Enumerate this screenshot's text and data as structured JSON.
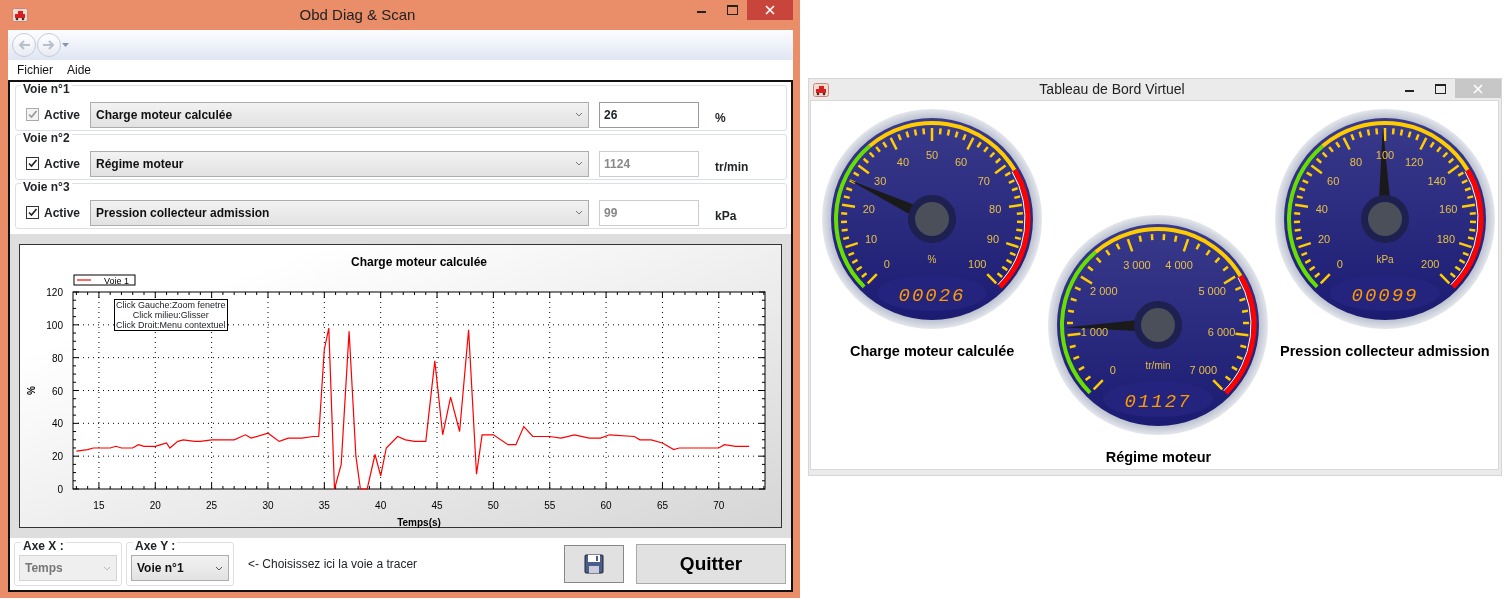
{
  "main_window": {
    "title": "Obd Diag & Scan",
    "menu": [
      "Fichier",
      "Aide"
    ],
    "channels": [
      {
        "group": "Voie n°1",
        "active": {
          "label": "Active",
          "checked": true,
          "disabled": true
        },
        "parameter": "Charge moteur calculée",
        "value": {
          "text": "26",
          "disabled": false
        },
        "unit": "%"
      },
      {
        "group": "Voie n°2",
        "active": {
          "label": "Active",
          "checked": true,
          "disabled": false
        },
        "parameter": "Régime moteur",
        "value": {
          "text": "1124",
          "disabled": true
        },
        "unit": "tr/min"
      },
      {
        "group": "Voie n°3",
        "active": {
          "label": "Active",
          "checked": true,
          "disabled": false
        },
        "parameter": "Pression collecteur admission",
        "value": {
          "text": "99",
          "disabled": true
        },
        "unit": "kPa"
      }
    ],
    "chart": {
      "help_box": [
        "Click Gauche:Zoom fenetre",
        "Click milieu:Glisser",
        "Click Droit:Menu contextuel"
      ],
      "chart_data": {
        "type": "line",
        "title": "Charge moteur calculée",
        "xlabel": "Temps(s)",
        "ylabel": "%",
        "x": [
          13,
          14,
          14.5,
          16,
          16.5,
          17,
          18,
          18.5,
          19,
          20,
          20.5,
          21,
          21.3,
          22,
          22.5,
          23.5,
          24,
          25,
          27,
          28,
          28.5,
          30,
          31,
          31.8,
          33,
          34,
          34.5,
          35,
          35.4,
          35.9,
          36.5,
          37.2,
          37.8,
          38.2,
          38.8,
          39.5,
          40,
          40.5,
          41.5,
          42.2,
          43,
          44,
          44.8,
          45.5,
          46.2,
          47,
          47.8,
          48.5,
          49,
          50,
          51.3,
          52,
          52.7,
          53.5,
          55,
          56,
          57.2,
          58.5,
          59.5,
          60.3,
          62.5,
          63,
          64,
          65,
          66,
          66.5,
          70,
          70.5,
          71.5,
          72.7
        ],
        "series": [
          {
            "name": "Voie 1",
            "color": "#ff0000",
            "values": [
              23,
              24,
              25,
              25,
              26,
              25,
              25,
              27,
              26,
              26,
              27,
              28,
              25,
              29,
              30,
              29,
              29,
              30,
              30,
              33,
              31,
              34,
              29,
              31,
              31,
              32,
              32,
              85,
              98,
              0,
              15,
              96,
              20,
              0,
              0,
              21,
              8,
              25,
              32,
              30,
              29,
              29,
              78,
              33,
              56,
              35,
              97,
              9,
              33,
              33,
              27,
              27,
              38,
              32,
              32,
              31,
              33,
              31,
              31,
              33,
              32,
              30,
              30,
              28,
              24,
              25,
              25,
              27,
              26,
              26
            ]
          }
        ],
        "grid": true,
        "xlim": [
          12.7,
          74.1
        ],
        "ylim": [
          0,
          120
        ],
        "xticks": [
          15,
          20,
          25,
          30,
          35,
          40,
          45,
          50,
          55,
          60,
          65,
          70
        ],
        "yticks": [
          0,
          20,
          40,
          60,
          80,
          100,
          120
        ]
      }
    },
    "axis_x": {
      "label": "Axe X :",
      "value": "Temps",
      "disabled": true
    },
    "axis_y": {
      "label": "Axe Y :",
      "value": "Voie n°1",
      "disabled": false
    },
    "hint": "<- Choisissez ici la voie a tracer",
    "quit_button": "Quitter"
  },
  "dashboard_window": {
    "title": "Tableau de Bord Virtuel",
    "gauges": [
      {
        "title": "Charge moteur calculée",
        "unit": "%",
        "readout": "00026",
        "level": 0.26,
        "ticks": [
          "0",
          "10",
          "20",
          "30",
          "40",
          "50",
          "60",
          "70",
          "80",
          "90",
          "100"
        ]
      },
      {
        "title": "Régime moteur",
        "unit": "tr/min",
        "readout": "01127",
        "level": 0.161,
        "ticks": [
          "0",
          "1 000",
          "2 000",
          "3 000",
          "4 000",
          "5 000",
          "6 000",
          "7 000"
        ]
      },
      {
        "title": "Pression collecteur admission",
        "unit": "kPa",
        "readout": "00099",
        "level": 0.495,
        "ticks": [
          "0",
          "20",
          "40",
          "60",
          "80",
          "100",
          "120",
          "140",
          "160",
          "180",
          "200"
        ]
      }
    ]
  }
}
